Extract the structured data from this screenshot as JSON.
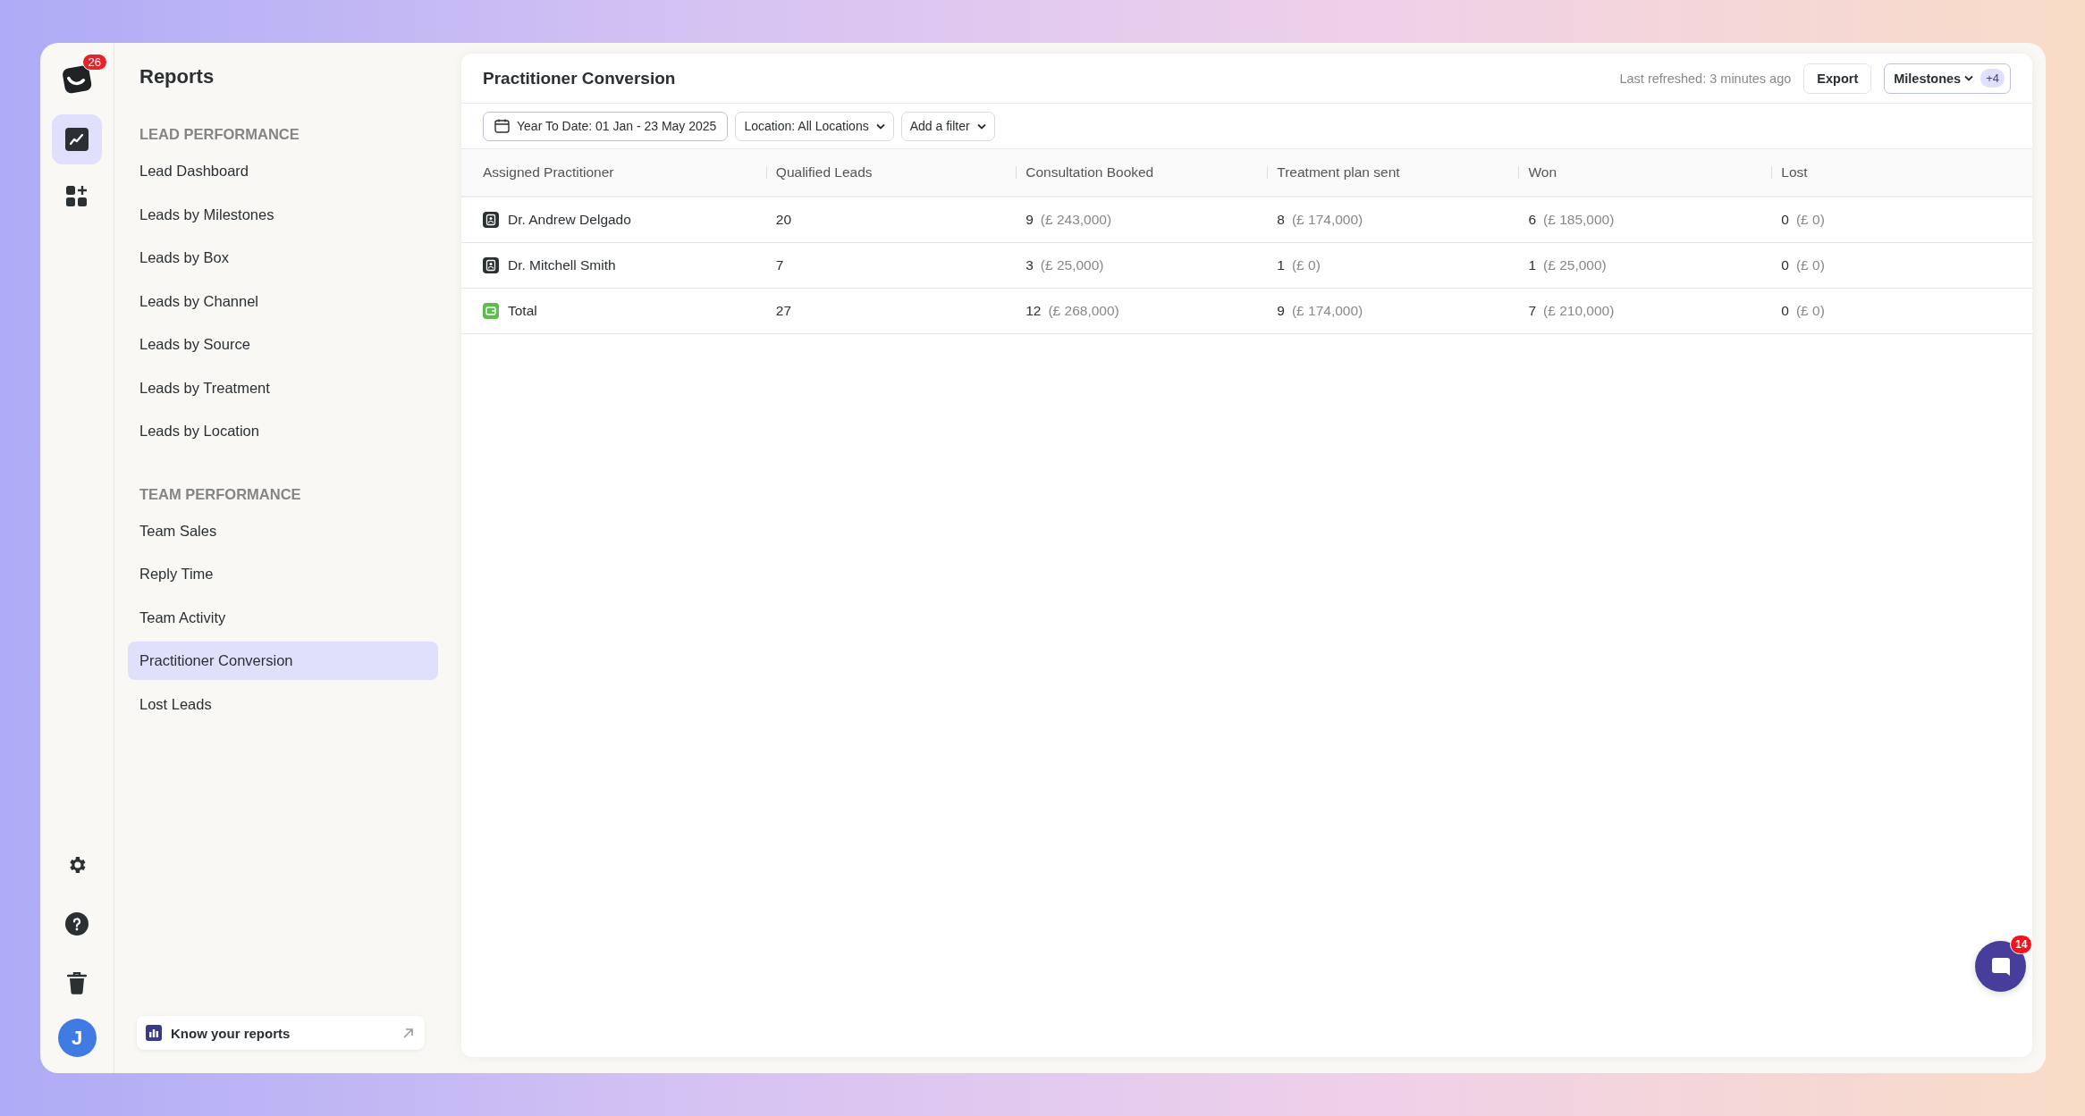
{
  "rail": {
    "notification_badge": "26",
    "items": [
      {
        "kind": "reports",
        "selected": true
      },
      {
        "kind": "widgets",
        "selected": false
      }
    ],
    "bottom_items": [
      {
        "kind": "settings"
      },
      {
        "kind": "help"
      },
      {
        "kind": "trash"
      }
    ],
    "avatar": "J"
  },
  "sidebar": {
    "title": "Reports",
    "sections": [
      {
        "heading": "LEAD PERFORMANCE",
        "items": [
          {
            "label": "Lead Dashboard",
            "selected": false
          },
          {
            "label": "Leads by Milestones",
            "selected": false
          },
          {
            "label": "Leads by Box",
            "selected": false
          },
          {
            "label": "Leads by Channel",
            "selected": false
          },
          {
            "label": "Leads by Source",
            "selected": false
          },
          {
            "label": "Leads by Treatment",
            "selected": false
          },
          {
            "label": "Leads by Location",
            "selected": false
          }
        ]
      },
      {
        "heading": "TEAM PERFORMANCE",
        "items": [
          {
            "label": "Team Sales",
            "selected": false
          },
          {
            "label": "Reply Time",
            "selected": false
          },
          {
            "label": "Team Activity",
            "selected": false
          },
          {
            "label": "Practitioner Conversion",
            "selected": true
          },
          {
            "label": "Lost Leads",
            "selected": false
          }
        ]
      }
    ],
    "footer_link": "Know your reports"
  },
  "report": {
    "title": "Practitioner Conversion",
    "last_refreshed": "Last refreshed: 3 minutes ago",
    "export_button": "Export",
    "milestones_button": {
      "label": "Milestones",
      "count": "+4"
    },
    "filters": [
      {
        "kind": "date",
        "label": "Year To Date: 01 Jan - 23 May 2025"
      },
      {
        "kind": "dropdown",
        "label": "Location: All Locations"
      },
      {
        "kind": "dropdown",
        "label": "Add a filter"
      }
    ],
    "table": {
      "columns": [
        "Assigned Practitioner",
        "Qualified Leads",
        "Consultation Booked",
        "Treatment plan sent",
        "Won",
        "Lost"
      ],
      "rows": [
        {
          "kind": "practitioner",
          "name": "Dr. Andrew Delgado",
          "qualified": "20",
          "stages": [
            {
              "count": "9",
              "amount": "(£ 243,000)"
            },
            {
              "count": "8",
              "amount": "(£ 174,000)"
            },
            {
              "count": "6",
              "amount": "(£ 185,000)"
            },
            {
              "count": "0",
              "amount": "(£ 0)"
            }
          ]
        },
        {
          "kind": "practitioner",
          "name": "Dr. Mitchell Smith",
          "qualified": "7",
          "stages": [
            {
              "count": "3",
              "amount": "(£ 25,000)"
            },
            {
              "count": "1",
              "amount": "(£ 0)"
            },
            {
              "count": "1",
              "amount": "(£ 25,000)"
            },
            {
              "count": "0",
              "amount": "(£ 0)"
            }
          ]
        },
        {
          "kind": "total",
          "name": "Total",
          "qualified": "27",
          "stages": [
            {
              "count": "12",
              "amount": "(£ 268,000)"
            },
            {
              "count": "9",
              "amount": "(£ 174,000)"
            },
            {
              "count": "7",
              "amount": "(£ 210,000)"
            },
            {
              "count": "0",
              "amount": "(£ 0)"
            }
          ]
        }
      ]
    }
  },
  "chat": {
    "badge": "14"
  }
}
